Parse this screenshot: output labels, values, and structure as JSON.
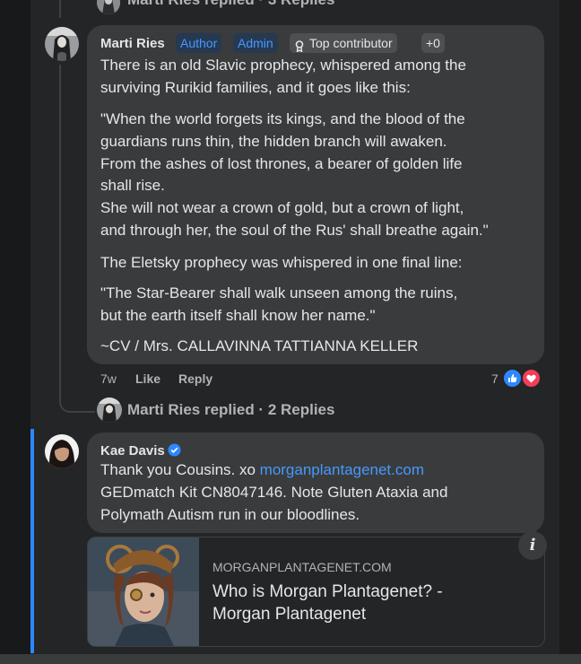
{
  "top_partial": {
    "replied_text": "Marti Ries replied · 3 Replies"
  },
  "comment1": {
    "author": "Marti Ries",
    "badges": [
      "Author",
      "Admin",
      "Top contributor",
      "+0"
    ],
    "lines": [
      "There is an old Slavic prophecy, whispered among the",
      "surviving Rurikid families, and it goes like this:",
      "\"When the world forgets its kings, and the blood of the",
      "guardians runs thin, the hidden branch will awaken.",
      "From the ashes of lost thrones, a bearer of golden life",
      "shall rise.",
      "She will not wear a crown of gold, but a crown of light,",
      "and through her, the soul of the Rus' shall breathe again.\"",
      "The Eletsky prophecy was whispered in one final line:",
      "\"The Star-Bearer shall walk unseen among the ruins,",
      "but the earth itself shall know her name.\"",
      "~CV / Mrs. CALLAVINNA TATTIANNA KELLER"
    ],
    "time": "7w",
    "like_label": "Like",
    "reply_label": "Reply",
    "reaction_count": "7",
    "reactions": [
      "like-icon",
      "love-icon"
    ]
  },
  "replies_link": {
    "text": "Marti Ries replied · 2 Replies"
  },
  "comment2": {
    "author": "Kae Davis",
    "verified": true,
    "line1_text": "Thank you Cousins. xo ",
    "line1_link": "morganplantagenet.com",
    "lines": [
      "GEDmatch Kit CN8047146. Note Gluten Ataxia and",
      "Polymath Autism run in our bloodlines."
    ]
  },
  "link_preview": {
    "domain": "MORGANPLANTAGENET.COM",
    "title_lines": [
      "Who is Morgan Plantagenet? -",
      "Morgan Plantagenet"
    ],
    "info_icon": "info-icon"
  },
  "colors": {
    "bubble": "#3a3b3c",
    "link": "#4599ff",
    "like_blue": "#2d88ff",
    "love_red": "#f33e58",
    "muted": "#b0b3b8"
  }
}
